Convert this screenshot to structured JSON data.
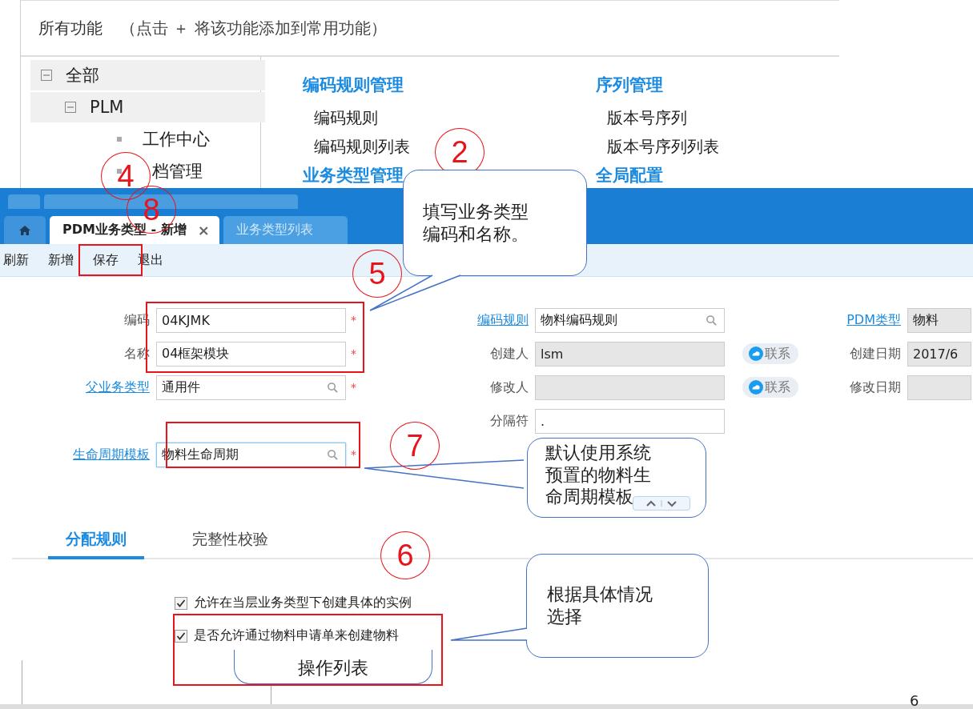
{
  "feature_panel": {
    "title": "所有功能",
    "hint": "（点击 ＋ 将该功能添加到常用功能）",
    "tree": [
      {
        "label": "全部",
        "expanded": true,
        "children": [
          {
            "label": "PLM",
            "expanded": true,
            "children": [
              {
                "label": "工作中心"
              },
              {
                "label": "档管理"
              }
            ]
          }
        ]
      }
    ],
    "groups": [
      {
        "title": "编码规则管理",
        "items": [
          "编码规则",
          "编码规则列表"
        ]
      },
      {
        "title": "序列管理",
        "items": [
          "版本号序列",
          "版本号序列列表"
        ]
      },
      {
        "title": "业务类型管理"
      },
      {
        "title": "全局配置"
      }
    ]
  },
  "tabs": [
    {
      "kind": "home",
      "selected": false
    },
    {
      "kind": "page",
      "label": "PDM业务类型 - 新增",
      "close": "×",
      "selected": true
    },
    {
      "kind": "page",
      "label": "业务类型列表",
      "selected": false
    }
  ],
  "toolbar": [
    "刷新",
    "新增",
    "保存",
    "退出"
  ],
  "form": {
    "columns": [
      {
        "fields": [
          {
            "label": "编码",
            "link": false,
            "value": "04KJMK",
            "required_mark": "*"
          },
          {
            "label": "名称",
            "link": false,
            "value": "04框架模块",
            "required_mark": "*"
          },
          {
            "label": "父业务类型",
            "link": true,
            "value": "通用件",
            "search": true,
            "required_mark": "*"
          },
          {
            "label": "生命周期模板",
            "link": true,
            "value": "物料生命周期",
            "search": true,
            "focused": true,
            "required_mark": "*"
          }
        ]
      },
      {
        "fields": [
          {
            "label": "编码规则",
            "link": true,
            "value": "物料编码规则",
            "search": true
          },
          {
            "label": "创建人",
            "link": false,
            "value": "lsm",
            "readonly": true,
            "action": "联系"
          },
          {
            "label": "修改人",
            "link": false,
            "readonly": true,
            "action": "联系"
          },
          {
            "label": "分隔符",
            "link": false,
            "value": "."
          }
        ]
      },
      {
        "fields": [
          {
            "label": "PDM类型",
            "link": true,
            "value": "物料",
            "readonly": true
          },
          {
            "label": "创建日期",
            "link": false,
            "value": "2017/6",
            "readonly": true
          },
          {
            "label": "修改日期",
            "link": false,
            "readonly": true
          }
        ]
      }
    ]
  },
  "detail_tabs": [
    {
      "label": "分配规则",
      "selected": true
    },
    {
      "label": "完整性校验",
      "selected": false
    }
  ],
  "options": [
    {
      "label": "允许在当层业务类型下创建具体的实例",
      "checked": true
    },
    {
      "label": "是否允许通过物料申请单来创建物料",
      "checked": true
    }
  ],
  "annotations": {
    "steps": [
      "4",
      "8",
      "2",
      "5",
      "7",
      "6"
    ],
    "callouts": [
      "填写业务类型编码和名称。",
      "默认使用系统预置的物料生命周期模板",
      "根据具体情况选择",
      "操作列表"
    ],
    "page_number": "6"
  }
}
